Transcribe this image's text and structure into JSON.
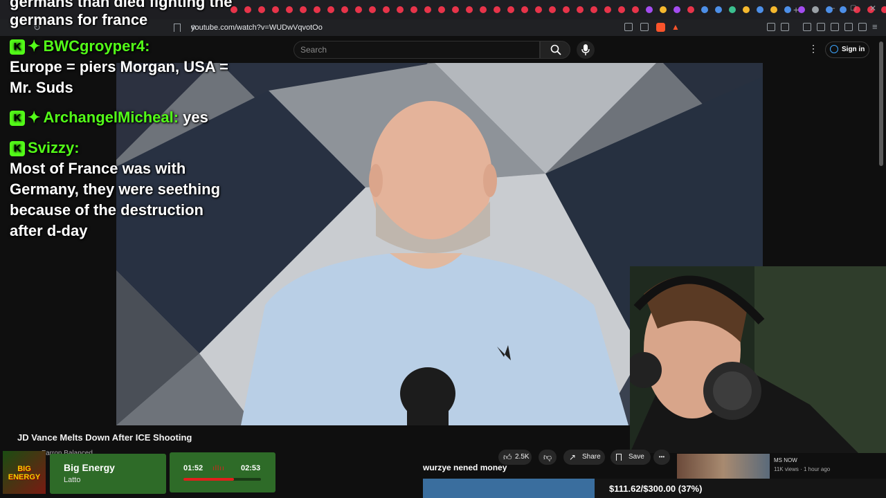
{
  "browser": {
    "url": "youtube.com/watch?v=WUDwVqvotOo",
    "tab_colors": [
      "#e8344a",
      "#e8344a",
      "#e8344a",
      "#e8344a",
      "#e8344a",
      "#e8344a",
      "#e8344a",
      "#e8344a",
      "#e8344a",
      "#e8344a",
      "#e8344a",
      "#e8344a",
      "#e8344a",
      "#e8344a",
      "#e8344a",
      "#e8344a",
      "#e8344a",
      "#e8344a",
      "#e8344a",
      "#e8344a",
      "#e8344a",
      "#e8344a",
      "#e8344a",
      "#e8344a",
      "#e8344a",
      "#e8344a",
      "#e8344a",
      "#e8344a",
      "#e8344a",
      "#e8344a",
      "#a44cf0",
      "#f5b82e",
      "#a44cf0",
      "#e8344a",
      "#4d8fe8",
      "#4d8fe8",
      "#3bbf8f",
      "#f5b82e",
      "#4d8fe8",
      "#f5b82e",
      "#4d8fe8",
      "#a44cf0",
      "#9aa0a6",
      "#4d8fe8",
      "#4d8fe8",
      "#e8344a",
      "#e8344a",
      "#e8344a",
      "#e8344a"
    ]
  },
  "youtube": {
    "search_placeholder": "Search",
    "signin_label": "Sign in",
    "video_title": "JD Vance Melts Down After ICE Shooting",
    "channel_name": "Farron Balanced",
    "likes": "2.5K",
    "share_label": "Share",
    "save_label": "Save",
    "more_label": "•••",
    "related": {
      "channel": "MS NOW",
      "meta": "11K views · 1 hour ago"
    }
  },
  "overlay": {
    "alert_line1": "germans than died fighting the",
    "alert_line2": "germans for france",
    "chat": [
      {
        "user": "BWCgroyper4:",
        "message": "Europe = piers Morgan, USA = Mr. Suds"
      },
      {
        "user": "ArchangelMicheal:",
        "message": "yes"
      },
      {
        "user": "Svizzy:",
        "message": "Most of France was with Germany, they were seething because of the destruction after d-day"
      }
    ],
    "caption": "wurzye nened money",
    "donation": {
      "label": "$111.62/$300.00 (37%)",
      "fraction": 0.37,
      "color": "#3a6e9e"
    }
  },
  "music": {
    "song": "Big Energy",
    "artist": "Latto",
    "album_text": "BIG ENERGY",
    "current": "01:52",
    "total": "02:53",
    "progress": 0.65,
    "accent": "#e0201c"
  },
  "colors": {
    "kick_green": "#53fc18",
    "yt_background": "#0f0f0f"
  }
}
